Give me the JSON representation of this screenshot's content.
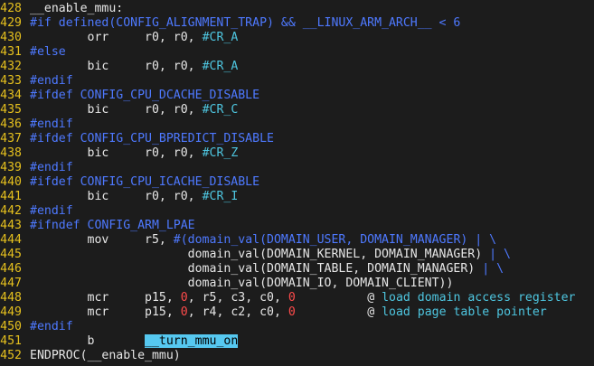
{
  "editor": {
    "lines": [
      {
        "num": "428",
        "segs": [
          {
            "t": "__enable_mmu:",
            "c": "lbl"
          }
        ]
      },
      {
        "num": "429",
        "segs": [
          {
            "t": "#if defined(CONFIG_ALIGNMENT_TRAP) && __LINUX_ARM_ARCH__ < 6",
            "c": "pre"
          }
        ]
      },
      {
        "num": "430",
        "segs": [
          {
            "t": "        orr     r0, r0, ",
            "c": "norm"
          },
          {
            "t": "#CR_A",
            "c": "cmt"
          }
        ]
      },
      {
        "num": "431",
        "segs": [
          {
            "t": "#else",
            "c": "pre"
          }
        ]
      },
      {
        "num": "432",
        "segs": [
          {
            "t": "        bic     r0, r0, ",
            "c": "norm"
          },
          {
            "t": "#CR_A",
            "c": "cmt"
          }
        ]
      },
      {
        "num": "433",
        "segs": [
          {
            "t": "#endif",
            "c": "pre"
          }
        ]
      },
      {
        "num": "434",
        "segs": [
          {
            "t": "#ifdef CONFIG_CPU_DCACHE_DISABLE",
            "c": "pre"
          }
        ]
      },
      {
        "num": "435",
        "segs": [
          {
            "t": "        bic     r0, r0, ",
            "c": "norm"
          },
          {
            "t": "#CR_C",
            "c": "cmt"
          }
        ]
      },
      {
        "num": "436",
        "segs": [
          {
            "t": "#endif",
            "c": "pre"
          }
        ]
      },
      {
        "num": "437",
        "segs": [
          {
            "t": "#ifdef CONFIG_CPU_BPREDICT_DISABLE",
            "c": "pre"
          }
        ]
      },
      {
        "num": "438",
        "segs": [
          {
            "t": "        bic     r0, r0, ",
            "c": "norm"
          },
          {
            "t": "#CR_Z",
            "c": "cmt"
          }
        ]
      },
      {
        "num": "439",
        "segs": [
          {
            "t": "#endif",
            "c": "pre"
          }
        ]
      },
      {
        "num": "440",
        "segs": [
          {
            "t": "#ifdef CONFIG_CPU_ICACHE_DISABLE",
            "c": "pre"
          }
        ]
      },
      {
        "num": "441",
        "segs": [
          {
            "t": "        bic     r0, r0, ",
            "c": "norm"
          },
          {
            "t": "#CR_I",
            "c": "cmt"
          }
        ]
      },
      {
        "num": "442",
        "segs": [
          {
            "t": "#endif",
            "c": "pre"
          }
        ]
      },
      {
        "num": "443",
        "segs": [
          {
            "t": "#ifndef CONFIG_ARM_LPAE",
            "c": "pre"
          }
        ]
      },
      {
        "num": "444",
        "segs": [
          {
            "t": "        mov     r5, ",
            "c": "norm"
          },
          {
            "t": "#(domain_val(DOMAIN_USER, DOMAIN_MANAGER) | \\",
            "c": "pre"
          }
        ]
      },
      {
        "num": "445",
        "segs": [
          {
            "t": "                      domain_val(DOMAIN_KERNEL, DOMAIN_MANAGER) ",
            "c": "norm"
          },
          {
            "t": "| \\",
            "c": "pre"
          }
        ]
      },
      {
        "num": "446",
        "segs": [
          {
            "t": "                      domain_val(DOMAIN_TABLE, DOMAIN_MANAGER) ",
            "c": "norm"
          },
          {
            "t": "| \\",
            "c": "pre"
          }
        ]
      },
      {
        "num": "447",
        "segs": [
          {
            "t": "                      domain_val(DOMAIN_IO, DOMAIN_CLIENT))",
            "c": "norm"
          }
        ]
      },
      {
        "num": "448",
        "segs": [
          {
            "t": "        mcr     p15, ",
            "c": "norm"
          },
          {
            "t": "0",
            "c": "num"
          },
          {
            "t": ", r5, c3, c0, ",
            "c": "norm"
          },
          {
            "t": "0",
            "c": "num"
          },
          {
            "t": "          ",
            "c": "norm"
          },
          {
            "t": "@",
            "c": "lbl"
          },
          {
            "t": " load domain access register",
            "c": "cmt"
          }
        ]
      },
      {
        "num": "449",
        "segs": [
          {
            "t": "        mcr     p15, ",
            "c": "norm"
          },
          {
            "t": "0",
            "c": "num"
          },
          {
            "t": ", r4, c2, c0, ",
            "c": "norm"
          },
          {
            "t": "0",
            "c": "num"
          },
          {
            "t": "          ",
            "c": "norm"
          },
          {
            "t": "@",
            "c": "lbl"
          },
          {
            "t": " load page table pointer",
            "c": "cmt"
          }
        ]
      },
      {
        "num": "450",
        "segs": [
          {
            "t": "#endif",
            "c": "pre"
          }
        ]
      },
      {
        "num": "451",
        "segs": [
          {
            "t": "        b       ",
            "c": "norm"
          },
          {
            "t": "__turn_mmu_on",
            "c": "hl"
          }
        ]
      },
      {
        "num": "452",
        "segs": [
          {
            "t": "ENDPROC(__enable_mmu)",
            "c": "lbl"
          }
        ]
      }
    ]
  },
  "colors": {
    "background": "#1c1c1c",
    "line_number": "#e5c01e",
    "preprocessor": "#4e79ff",
    "number": "#ff4b4b",
    "comment": "#4ec6e0",
    "highlight": "#56c8f0"
  }
}
